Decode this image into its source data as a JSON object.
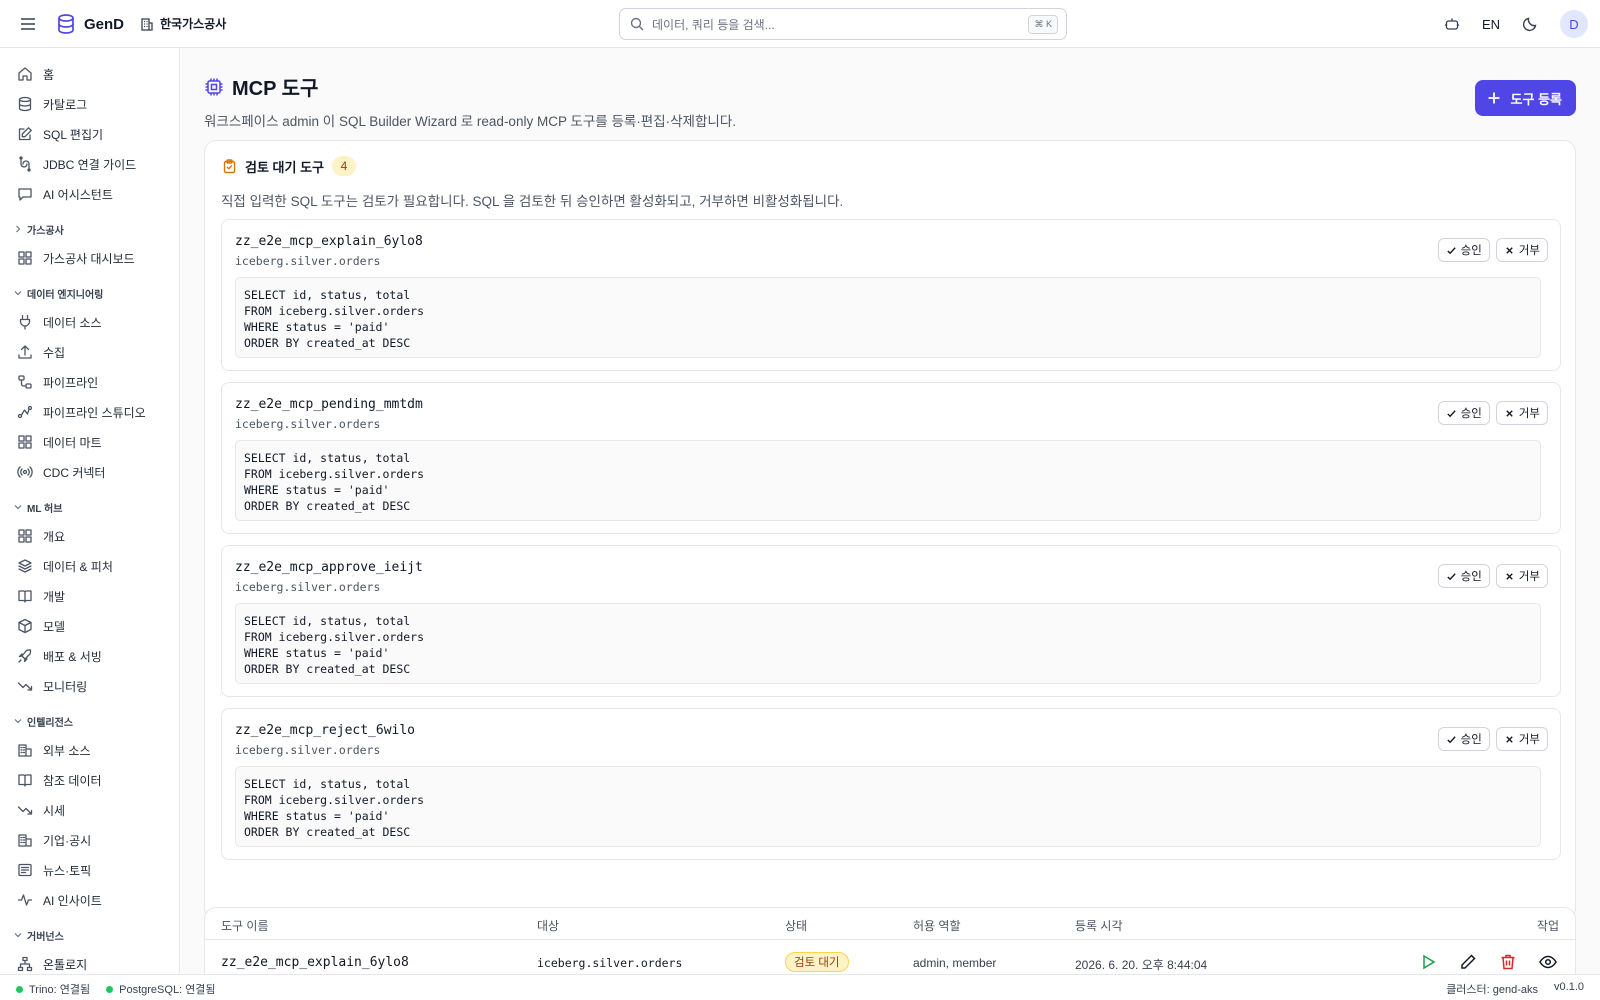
{
  "topbar": {
    "brand": "GenD",
    "org": "한국가스공사",
    "search_placeholder": "데이터, 쿼리 등을 검색...",
    "search_shortcut": "⌘ K",
    "lang": "EN",
    "avatar": "D"
  },
  "sidebar": {
    "top": [
      {
        "label": "홈",
        "icon": "home-icon"
      },
      {
        "label": "카탈로그",
        "icon": "database-icon"
      },
      {
        "label": "SQL 편집기",
        "icon": "edit-icon"
      },
      {
        "label": "JDBC 연결 가이드",
        "icon": "link-icon"
      },
      {
        "label": "AI 어시스턴트",
        "icon": "chat-icon"
      }
    ],
    "sections": [
      {
        "title": "가스공사",
        "collapsed": true,
        "items": [
          {
            "label": "가스공사 대시보드",
            "icon": "dashboard-icon"
          }
        ]
      },
      {
        "title": "데이터 엔지니어링",
        "items": [
          {
            "label": "데이터 소스",
            "icon": "plug-icon"
          },
          {
            "label": "수집",
            "icon": "upload-icon"
          },
          {
            "label": "파이프라인",
            "icon": "pipeline-icon"
          },
          {
            "label": "파이프라인 스튜디오",
            "icon": "flow-icon"
          },
          {
            "label": "데이터 마트",
            "icon": "grid-icon"
          },
          {
            "label": "CDC 커넥터",
            "icon": "radio-icon"
          }
        ]
      },
      {
        "title": "ML 허브",
        "items": [
          {
            "label": "개요",
            "icon": "grid-icon"
          },
          {
            "label": "데이터 & 피처",
            "icon": "layers-icon"
          },
          {
            "label": "개발",
            "icon": "book-icon"
          },
          {
            "label": "모델",
            "icon": "box-icon"
          },
          {
            "label": "배포 & 서빙",
            "icon": "rocket-icon"
          },
          {
            "label": "모니터링",
            "icon": "trend-icon"
          }
        ]
      },
      {
        "title": "인텔리전스",
        "items": [
          {
            "label": "외부 소스",
            "icon": "building-icon"
          },
          {
            "label": "참조 데이터",
            "icon": "book-icon"
          },
          {
            "label": "시세",
            "icon": "trend-icon"
          },
          {
            "label": "기업·공시",
            "icon": "building-icon"
          },
          {
            "label": "뉴스·토픽",
            "icon": "news-icon"
          },
          {
            "label": "AI 인사이트",
            "icon": "pulse-icon"
          }
        ]
      },
      {
        "title": "거버넌스",
        "items": [
          {
            "label": "온톨로지",
            "icon": "network-icon"
          }
        ]
      }
    ]
  },
  "page": {
    "title": "MCP 도구",
    "subtitle": "워크스페이스 admin 이 SQL Builder Wizard 로 read-only MCP 도구를 등록·편집·삭제합니다.",
    "register_button": "도구 등록"
  },
  "pending": {
    "title": "검토 대기 도구",
    "count": "4",
    "description": "직접 입력한 SQL 도구는 검토가 필요합니다. SQL 을 검토한 뒤 승인하면 활성화되고, 거부하면 비활성화됩니다.",
    "approve_label": "승인",
    "reject_label": "거부",
    "tools": [
      {
        "name": "zz_e2e_mcp_explain_6ylo8",
        "target": "iceberg.silver.orders",
        "sql": "SELECT id, status, total\nFROM iceberg.silver.orders\nWHERE status = 'paid'\nORDER BY created_at DESC"
      },
      {
        "name": "zz_e2e_mcp_pending_mmtdm",
        "target": "iceberg.silver.orders",
        "sql": "SELECT id, status, total\nFROM iceberg.silver.orders\nWHERE status = 'paid'\nORDER BY created_at DESC"
      },
      {
        "name": "zz_e2e_mcp_approve_ieijt",
        "target": "iceberg.silver.orders",
        "sql": "SELECT id, status, total\nFROM iceberg.silver.orders\nWHERE status = 'paid'\nORDER BY created_at DESC"
      },
      {
        "name": "zz_e2e_mcp_reject_6wilo",
        "target": "iceberg.silver.orders",
        "sql": "SELECT id, status, total\nFROM iceberg.silver.orders\nWHERE status = 'paid'\nORDER BY created_at DESC"
      }
    ]
  },
  "table": {
    "columns": [
      "도구 이름",
      "대상",
      "상태",
      "허용 역할",
      "등록 시각",
      "작업"
    ],
    "rows": [
      {
        "name": "zz_e2e_mcp_explain_6ylo8",
        "target": "iceberg.silver.orders",
        "status": "검토 대기",
        "roles": "admin, member",
        "registered": "2026. 6. 20. 오후 8:44:04"
      }
    ]
  },
  "statusbar": {
    "trino": "Trino: 연결됨",
    "postgres": "PostgreSQL: 연결됨",
    "cluster": "클러스터: gend-aks",
    "version": "v0.1.0"
  },
  "colors": {
    "accent": "#4f46e5",
    "warning_bg": "#fef3c7",
    "ok": "#22c55e",
    "danger": "#dc2626"
  }
}
